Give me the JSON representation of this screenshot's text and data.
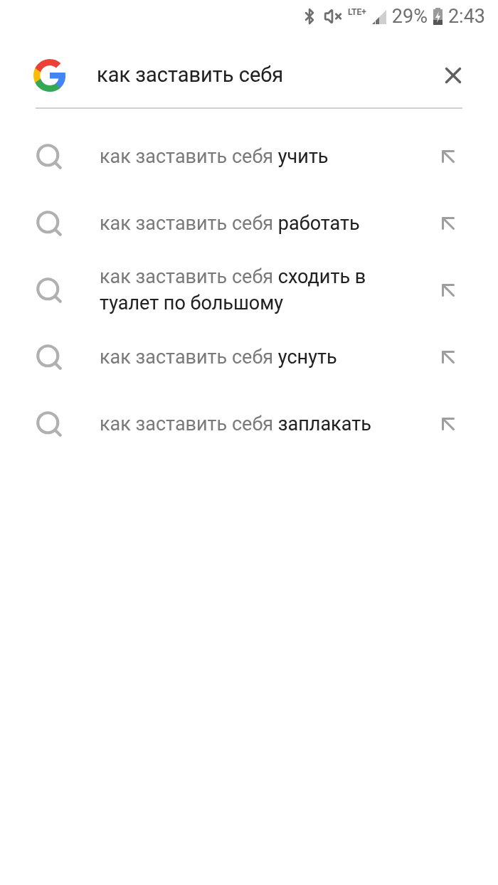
{
  "status_bar": {
    "network": "LTE+",
    "battery": "29%",
    "time": "2:43"
  },
  "search": {
    "value": "как заставить себя"
  },
  "suggestions": [
    {
      "prefix": "как заставить себя",
      "completion": "учить"
    },
    {
      "prefix": "как заставить себя",
      "completion": "работать"
    },
    {
      "prefix": "как заставить себя",
      "completion": "сходить в туалет по большому"
    },
    {
      "prefix": "как заставить себя",
      "completion": "уснуть"
    },
    {
      "prefix": "как заставить себя",
      "completion": "заплакать"
    }
  ]
}
